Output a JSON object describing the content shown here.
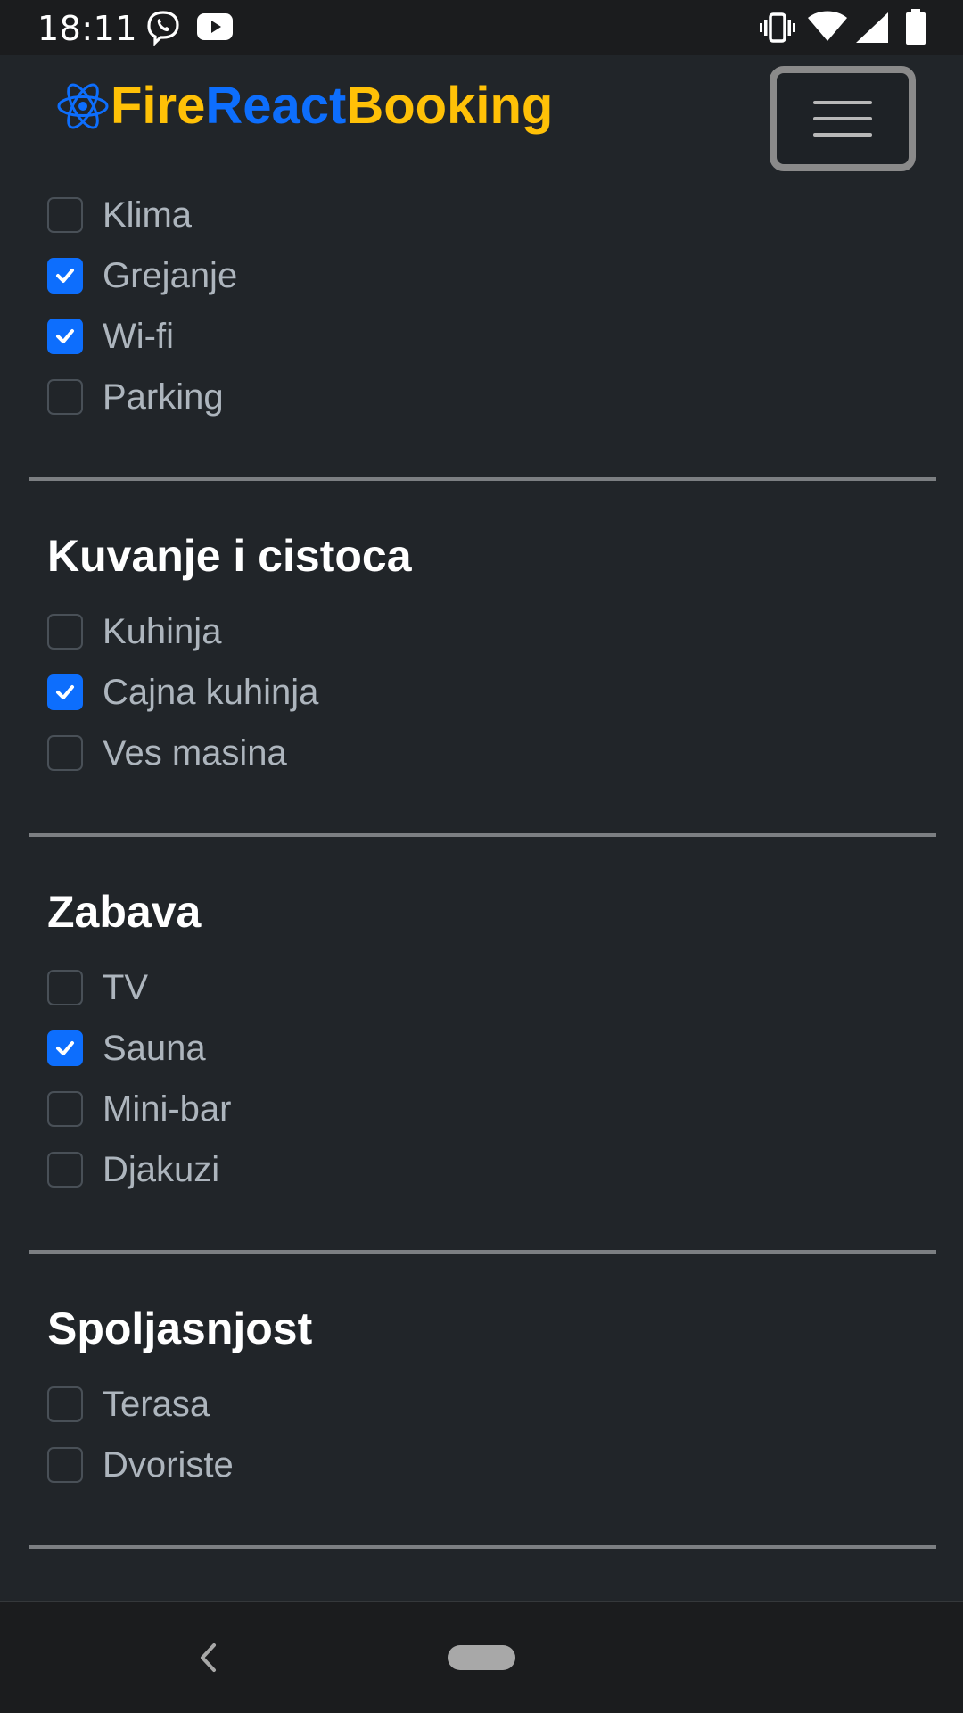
{
  "status_bar": {
    "time": "18:11",
    "left_icons": [
      "viber-icon",
      "youtube-icon"
    ],
    "right_icons": [
      "vibrate-icon",
      "wifi-icon",
      "signal-icon",
      "battery-icon"
    ]
  },
  "header": {
    "brand_part1": "Fire",
    "brand_part2": "React",
    "brand_part3": "Booking",
    "brand_icon": "react-atom-icon",
    "menu_icon": "hamburger-menu-icon"
  },
  "colors": {
    "background": "#212529",
    "accent_blue": "#0d6efd",
    "brand_yellow": "#ffc107",
    "label_gray": "#adb5bd"
  },
  "sections": [
    {
      "title": "",
      "items": [
        {
          "label": "Klima",
          "checked": false
        },
        {
          "label": "Grejanje",
          "checked": true
        },
        {
          "label": "Wi-fi",
          "checked": true
        },
        {
          "label": "Parking",
          "checked": false
        }
      ]
    },
    {
      "title": "Kuvanje i cistoca",
      "items": [
        {
          "label": "Kuhinja",
          "checked": false
        },
        {
          "label": "Cajna kuhinja",
          "checked": true
        },
        {
          "label": "Ves masina",
          "checked": false
        }
      ]
    },
    {
      "title": "Zabava",
      "items": [
        {
          "label": "TV",
          "checked": false
        },
        {
          "label": "Sauna",
          "checked": true
        },
        {
          "label": "Mini-bar",
          "checked": false
        },
        {
          "label": "Djakuzi",
          "checked": false
        }
      ]
    },
    {
      "title": "Spoljasnjost",
      "items": [
        {
          "label": "Terasa",
          "checked": false
        },
        {
          "label": "Dvoriste",
          "checked": false
        }
      ]
    }
  ],
  "nav_bar": {
    "back_icon": "back-chevron-icon",
    "home_icon": "home-pill-icon"
  }
}
